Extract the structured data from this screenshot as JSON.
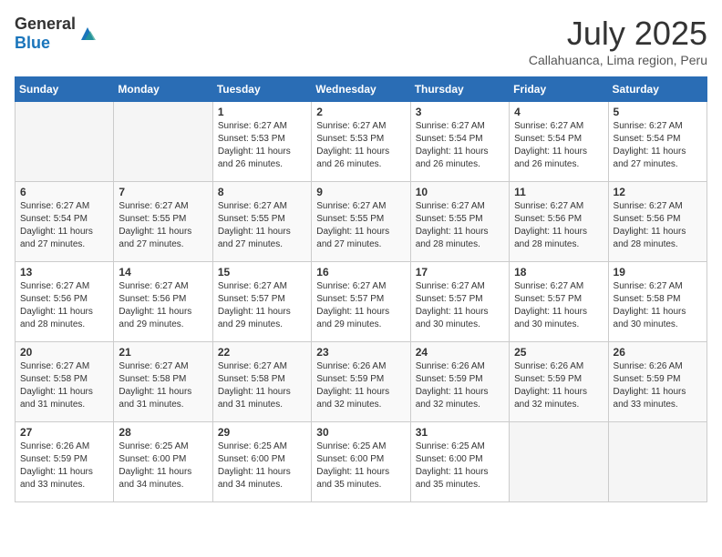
{
  "header": {
    "logo_general": "General",
    "logo_blue": "Blue",
    "month_title": "July 2025",
    "subtitle": "Callahuanca, Lima region, Peru"
  },
  "days_of_week": [
    "Sunday",
    "Monday",
    "Tuesday",
    "Wednesday",
    "Thursday",
    "Friday",
    "Saturday"
  ],
  "weeks": [
    [
      {
        "day": "",
        "info": ""
      },
      {
        "day": "",
        "info": ""
      },
      {
        "day": "1",
        "info": "Sunrise: 6:27 AM\nSunset: 5:53 PM\nDaylight: 11 hours and 26 minutes."
      },
      {
        "day": "2",
        "info": "Sunrise: 6:27 AM\nSunset: 5:53 PM\nDaylight: 11 hours and 26 minutes."
      },
      {
        "day": "3",
        "info": "Sunrise: 6:27 AM\nSunset: 5:54 PM\nDaylight: 11 hours and 26 minutes."
      },
      {
        "day": "4",
        "info": "Sunrise: 6:27 AM\nSunset: 5:54 PM\nDaylight: 11 hours and 26 minutes."
      },
      {
        "day": "5",
        "info": "Sunrise: 6:27 AM\nSunset: 5:54 PM\nDaylight: 11 hours and 27 minutes."
      }
    ],
    [
      {
        "day": "6",
        "info": "Sunrise: 6:27 AM\nSunset: 5:54 PM\nDaylight: 11 hours and 27 minutes."
      },
      {
        "day": "7",
        "info": "Sunrise: 6:27 AM\nSunset: 5:55 PM\nDaylight: 11 hours and 27 minutes."
      },
      {
        "day": "8",
        "info": "Sunrise: 6:27 AM\nSunset: 5:55 PM\nDaylight: 11 hours and 27 minutes."
      },
      {
        "day": "9",
        "info": "Sunrise: 6:27 AM\nSunset: 5:55 PM\nDaylight: 11 hours and 27 minutes."
      },
      {
        "day": "10",
        "info": "Sunrise: 6:27 AM\nSunset: 5:55 PM\nDaylight: 11 hours and 28 minutes."
      },
      {
        "day": "11",
        "info": "Sunrise: 6:27 AM\nSunset: 5:56 PM\nDaylight: 11 hours and 28 minutes."
      },
      {
        "day": "12",
        "info": "Sunrise: 6:27 AM\nSunset: 5:56 PM\nDaylight: 11 hours and 28 minutes."
      }
    ],
    [
      {
        "day": "13",
        "info": "Sunrise: 6:27 AM\nSunset: 5:56 PM\nDaylight: 11 hours and 28 minutes."
      },
      {
        "day": "14",
        "info": "Sunrise: 6:27 AM\nSunset: 5:56 PM\nDaylight: 11 hours and 29 minutes."
      },
      {
        "day": "15",
        "info": "Sunrise: 6:27 AM\nSunset: 5:57 PM\nDaylight: 11 hours and 29 minutes."
      },
      {
        "day": "16",
        "info": "Sunrise: 6:27 AM\nSunset: 5:57 PM\nDaylight: 11 hours and 29 minutes."
      },
      {
        "day": "17",
        "info": "Sunrise: 6:27 AM\nSunset: 5:57 PM\nDaylight: 11 hours and 30 minutes."
      },
      {
        "day": "18",
        "info": "Sunrise: 6:27 AM\nSunset: 5:57 PM\nDaylight: 11 hours and 30 minutes."
      },
      {
        "day": "19",
        "info": "Sunrise: 6:27 AM\nSunset: 5:58 PM\nDaylight: 11 hours and 30 minutes."
      }
    ],
    [
      {
        "day": "20",
        "info": "Sunrise: 6:27 AM\nSunset: 5:58 PM\nDaylight: 11 hours and 31 minutes."
      },
      {
        "day": "21",
        "info": "Sunrise: 6:27 AM\nSunset: 5:58 PM\nDaylight: 11 hours and 31 minutes."
      },
      {
        "day": "22",
        "info": "Sunrise: 6:27 AM\nSunset: 5:58 PM\nDaylight: 11 hours and 31 minutes."
      },
      {
        "day": "23",
        "info": "Sunrise: 6:26 AM\nSunset: 5:59 PM\nDaylight: 11 hours and 32 minutes."
      },
      {
        "day": "24",
        "info": "Sunrise: 6:26 AM\nSunset: 5:59 PM\nDaylight: 11 hours and 32 minutes."
      },
      {
        "day": "25",
        "info": "Sunrise: 6:26 AM\nSunset: 5:59 PM\nDaylight: 11 hours and 32 minutes."
      },
      {
        "day": "26",
        "info": "Sunrise: 6:26 AM\nSunset: 5:59 PM\nDaylight: 11 hours and 33 minutes."
      }
    ],
    [
      {
        "day": "27",
        "info": "Sunrise: 6:26 AM\nSunset: 5:59 PM\nDaylight: 11 hours and 33 minutes."
      },
      {
        "day": "28",
        "info": "Sunrise: 6:25 AM\nSunset: 6:00 PM\nDaylight: 11 hours and 34 minutes."
      },
      {
        "day": "29",
        "info": "Sunrise: 6:25 AM\nSunset: 6:00 PM\nDaylight: 11 hours and 34 minutes."
      },
      {
        "day": "30",
        "info": "Sunrise: 6:25 AM\nSunset: 6:00 PM\nDaylight: 11 hours and 35 minutes."
      },
      {
        "day": "31",
        "info": "Sunrise: 6:25 AM\nSunset: 6:00 PM\nDaylight: 11 hours and 35 minutes."
      },
      {
        "day": "",
        "info": ""
      },
      {
        "day": "",
        "info": ""
      }
    ]
  ]
}
